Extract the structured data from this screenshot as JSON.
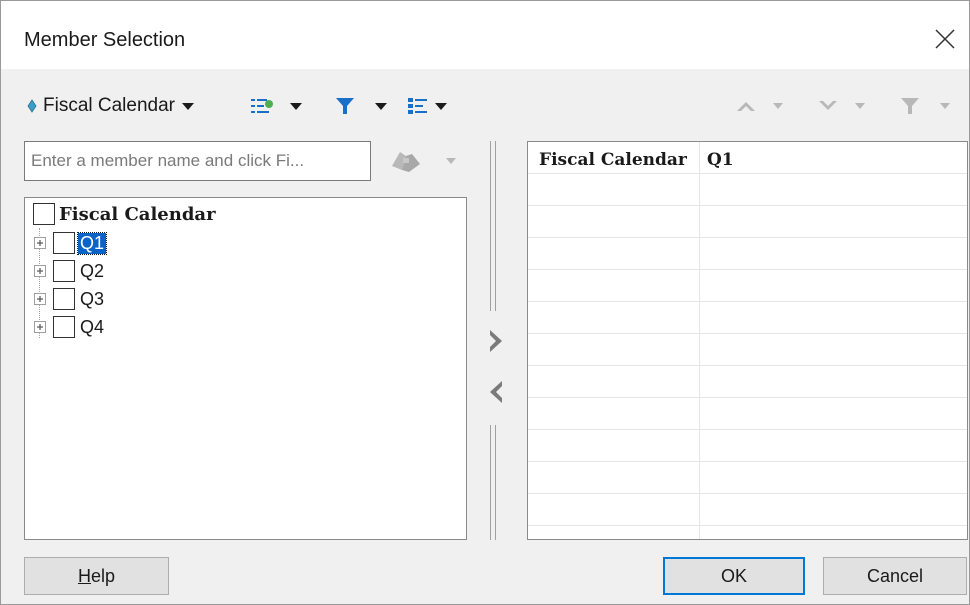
{
  "window": {
    "title": "Member Selection"
  },
  "toolbar": {
    "dimension_label": "Fiscal Calendar"
  },
  "search": {
    "placeholder": "Enter a member name and click Fi..."
  },
  "tree": {
    "root": {
      "label": "Fiscal Calendar",
      "checked": false
    },
    "items": [
      {
        "label": "Q1",
        "checked": false,
        "selected": true
      },
      {
        "label": "Q2",
        "checked": false,
        "selected": false
      },
      {
        "label": "Q3",
        "checked": false,
        "selected": false
      },
      {
        "label": "Q4",
        "checked": false,
        "selected": false
      }
    ]
  },
  "selection": {
    "header": {
      "dimension": "Fiscal Calendar",
      "member": "Q1"
    }
  },
  "buttons": {
    "help": "Help",
    "ok": "OK",
    "cancel": "Cancel"
  },
  "colors": {
    "accent": "#0078d7",
    "selection_bg": "#0a64c8",
    "filter_blue": "#1a6fc8"
  }
}
